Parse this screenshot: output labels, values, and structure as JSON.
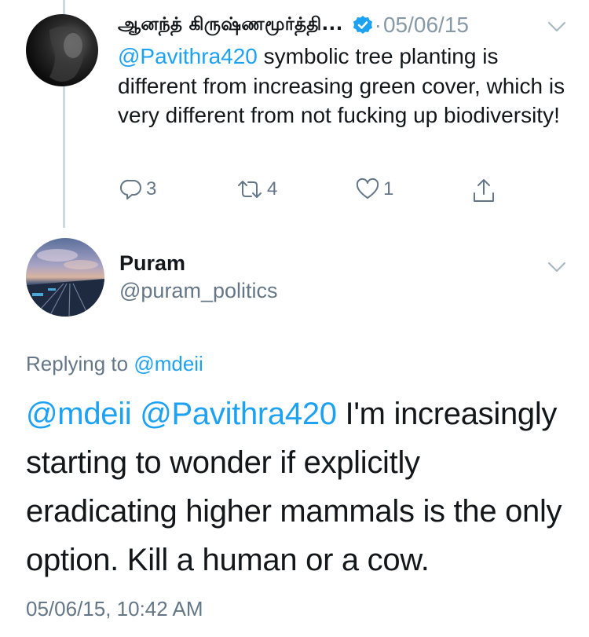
{
  "tweet1": {
    "display_name": "ஆனந்த் கிருஷ்ணமூர்த்தி...",
    "separator": "·",
    "date": "05/06/15",
    "body_mention": "@Pavithra420",
    "body_text": " symbolic tree planting is different from increasing green cover, which is very different from not fucking up biodiversity!",
    "reply_count": "3",
    "retweet_count": "4",
    "like_count": "1"
  },
  "tweet2": {
    "display_name": "Puram",
    "handle": "@puram_politics",
    "replying_prefix": "Replying to ",
    "replying_to": "@mdeii",
    "body_mention_1": "@mdeii",
    "body_mention_2": "@Pavithra420",
    "body_text": " I'm increasingly starting to wonder if explicitly eradicating higher mammals is the only option. Kill a human or a cow.",
    "timestamp": "05/06/15, 10:42 AM"
  },
  "colors": {
    "link": "#1da1f2",
    "secondary_text": "#657786",
    "primary_text": "#14171a",
    "thread_line": "#cfd9de"
  },
  "icons": [
    "reply-icon",
    "retweet-icon",
    "like-icon",
    "share-icon",
    "verified-badge-icon",
    "chevron-down-icon"
  ]
}
